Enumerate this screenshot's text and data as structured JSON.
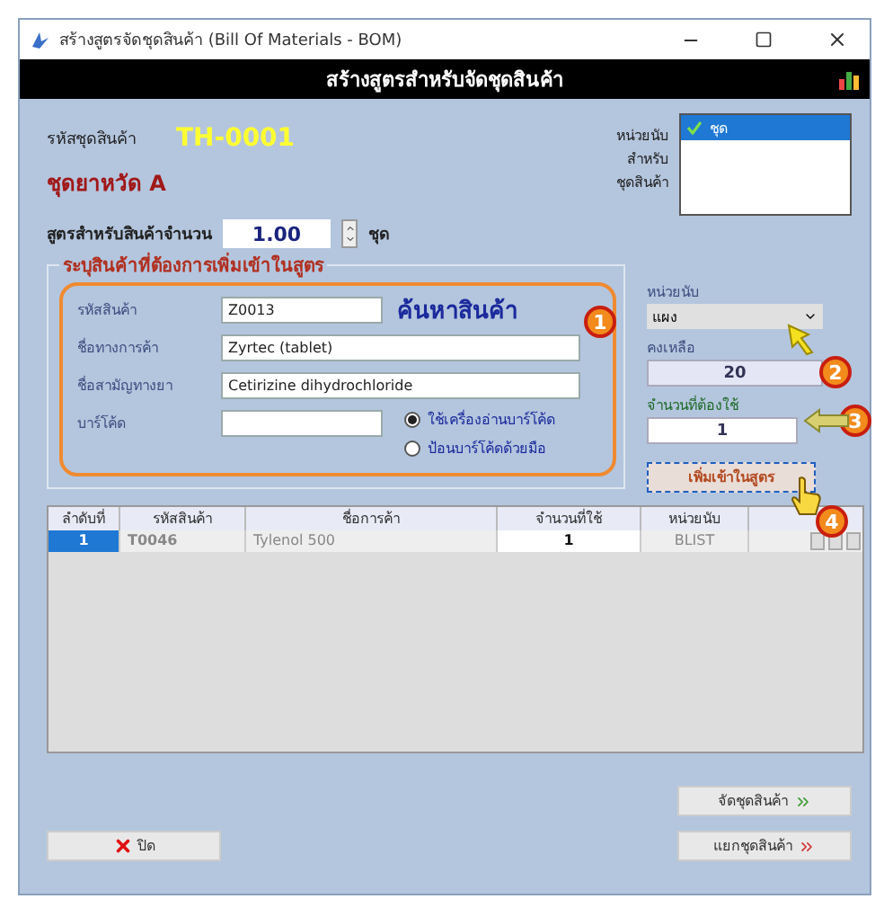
{
  "window": {
    "title": "สร้างสูตรจัดชุดสินค้า (Bill Of Materials - BOM)"
  },
  "header": {
    "title": "สร้างสูตรสำหรับจัดชุดสินค้า"
  },
  "kit": {
    "code_label": "รหัสชุดสินค้า",
    "code": "TH-0001",
    "name": "ชุดยาหวัด A"
  },
  "unit_list": {
    "label_lines": [
      "หน่วยนับ",
      "สำหรับ",
      "ชุดสินค้า"
    ],
    "items": [
      {
        "label": "ชุด",
        "selected": true
      }
    ]
  },
  "quantity": {
    "label": "สูตรสำหรับสินค้าจำนวน",
    "value": "1.00",
    "unit": "ชุด"
  },
  "group": {
    "title": "ระบุสินค้าที่ต้องการเพิ่มเข้าในสูตร",
    "search_label": "ค้นหาสินค้า",
    "fields": [
      {
        "label": "รหัสสินค้า",
        "value": "Z0013"
      },
      {
        "label": "ชื่อทางการค้า",
        "value": "Zyrtec (tablet)"
      },
      {
        "label": "ชื่อสามัญทางยา",
        "value": "Cetirizine dihydrochloride"
      },
      {
        "label": "บาร์โค้ด"
      }
    ],
    "barcode_modes": [
      {
        "label": "ใช้เครื่องอ่านบาร์โค้ด",
        "selected": true
      },
      {
        "label": "ป้อนบาร์โค้ดด้วยมือ",
        "selected": false
      }
    ]
  },
  "unit": {
    "label": "หน่วยนับ",
    "value": "แผง"
  },
  "stock": {
    "label": "คงเหลือ",
    "value": "20"
  },
  "required": {
    "label": "จำนวนที่ต้องใช้",
    "value": "1"
  },
  "add_button": "เพิ่มเข้าในสูตร",
  "steps": [
    "1",
    "2",
    "3",
    "4"
  ],
  "table": {
    "columns": [
      "ลำดับที่",
      "รหัสสินค้า",
      "ชื่อการค้า",
      "จำนวนที่ใช้",
      "หน่วยนับ"
    ],
    "rows": [
      {
        "cells": [
          "1",
          "T0046",
          "Tylenol 500",
          "1",
          "BLIST"
        ],
        "selected": true
      }
    ]
  },
  "buttons": {
    "assemble": "จัดชุดสินค้า",
    "disassemble": "แยกชุดสินค้า",
    "close": "ปิด"
  }
}
